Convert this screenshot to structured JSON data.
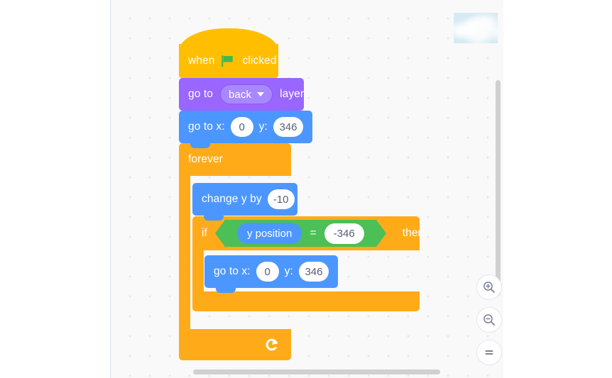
{
  "workspace": {
    "name": "scratch-block-workspace",
    "background_color": "#f9f9f9",
    "grid_dot_color": "#e6e6e6"
  },
  "backdrop_thumbnail": {
    "label": "backdrop-preview",
    "color": "#d4eaf4"
  },
  "script": {
    "blocks": [
      {
        "id": "when-flag-clicked",
        "category": "events",
        "color": "#ffbf00",
        "label_before": "when",
        "icon": "green-flag-icon",
        "label_after": "clicked"
      },
      {
        "id": "go-to-layer",
        "category": "looks",
        "color": "#9966ff",
        "label_before": "go to",
        "dropdown_value": "back",
        "label_after": "layer"
      },
      {
        "id": "go-to-xy-top",
        "category": "motion",
        "color": "#4c97ff",
        "label_x": "go to x:",
        "value_x": "0",
        "label_y": "y:",
        "value_y": "346"
      },
      {
        "id": "forever",
        "category": "control",
        "color": "#ffab19",
        "label": "forever",
        "icon": "loop-arrow-icon"
      },
      {
        "id": "change-y-by",
        "category": "motion",
        "color": "#4c97ff",
        "label": "change y by",
        "value": "-10"
      },
      {
        "id": "if-then",
        "category": "control",
        "color": "#ffab19",
        "label_if": "if",
        "label_then": "then"
      },
      {
        "id": "equals-operator",
        "category": "operators",
        "color": "#4cbf56",
        "left_operand": "y position",
        "operator": "=",
        "right_operand": "-346"
      },
      {
        "id": "go-to-xy-inner",
        "category": "motion",
        "color": "#4c97ff",
        "label_x": "go to x:",
        "value_x": "0",
        "label_y": "y:",
        "value_y": "346"
      }
    ]
  },
  "zoom_controls": {
    "zoom_in": "zoom-in-icon",
    "zoom_out": "zoom-out-icon",
    "zoom_reset": "zoom-reset-icon"
  },
  "scrollbars": {
    "vertical": "vertical-scrollbar",
    "horizontal": "horizontal-scrollbar"
  }
}
